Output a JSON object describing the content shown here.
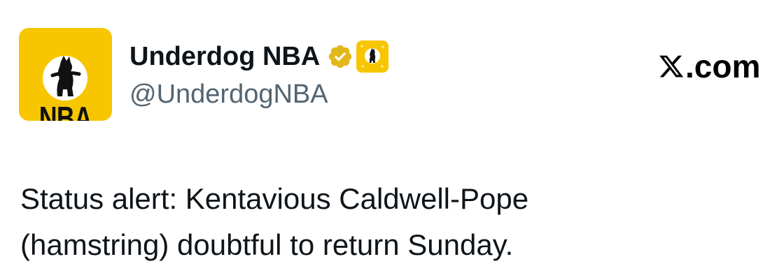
{
  "author": {
    "avatar_text": "NBA",
    "display_name": "Underdog NBA",
    "handle": "@UnderdogNBA",
    "verified_icon": "gold-verified-checkmark-icon",
    "affiliate_badge_icon": "underdog-dog-logo-icon"
  },
  "site_mark": {
    "icon": "x-logo-icon",
    "text": ".com"
  },
  "tweet": {
    "lines": [
      "Status alert: Kentavious Caldwell-Pope",
      "(hamstring) doubtful to return Sunday."
    ]
  },
  "colors": {
    "brand_yellow": "#f7c600",
    "verified_gold": "#e2b719",
    "text_primary": "#0f1419",
    "text_secondary": "#536471"
  }
}
